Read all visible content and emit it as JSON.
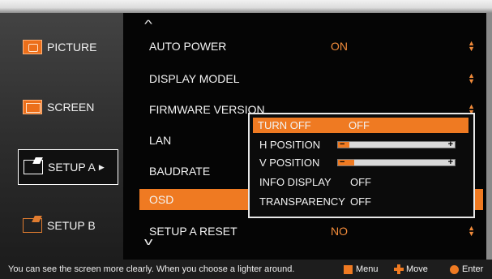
{
  "sidebar": {
    "items": [
      {
        "label": "PICTURE",
        "icon": "picture-icon"
      },
      {
        "label": "SCREEN",
        "icon": "screen-icon"
      },
      {
        "label": "SETUP A",
        "icon": "setup-a-icon",
        "active": true
      },
      {
        "label": "SETUP B",
        "icon": "setup-b-icon"
      }
    ]
  },
  "menu": {
    "rows": [
      {
        "label": "AUTO POWER",
        "value": "ON"
      },
      {
        "label": "DISPLAY MODEL",
        "value": ""
      },
      {
        "label": "FIRMWARE VERSION",
        "value": ""
      },
      {
        "label": "LAN",
        "value": ""
      },
      {
        "label": "BAUDRATE",
        "value": ""
      },
      {
        "label": "OSD",
        "value": ""
      },
      {
        "label": "SETUP A RESET",
        "value": "NO"
      }
    ]
  },
  "osd_popup": {
    "turn_off": {
      "label": "TURN OFF",
      "value": "OFF"
    },
    "h_position": {
      "label": "H POSITION",
      "level": 0.1
    },
    "v_position": {
      "label": "V POSITION",
      "level": 0.14
    },
    "info_display": {
      "label": "INFO DISPLAY",
      "value": "OFF"
    },
    "transparency": {
      "label": "TRANSPARENCY",
      "value": "OFF"
    }
  },
  "status": {
    "message": "You can see the screen more clearly.  When you choose a lighter around.",
    "menu_label": "Menu",
    "move_label": "Move",
    "enter_label": "Enter"
  },
  "colors": {
    "accent": "#ef7a22",
    "background": "#000000"
  }
}
